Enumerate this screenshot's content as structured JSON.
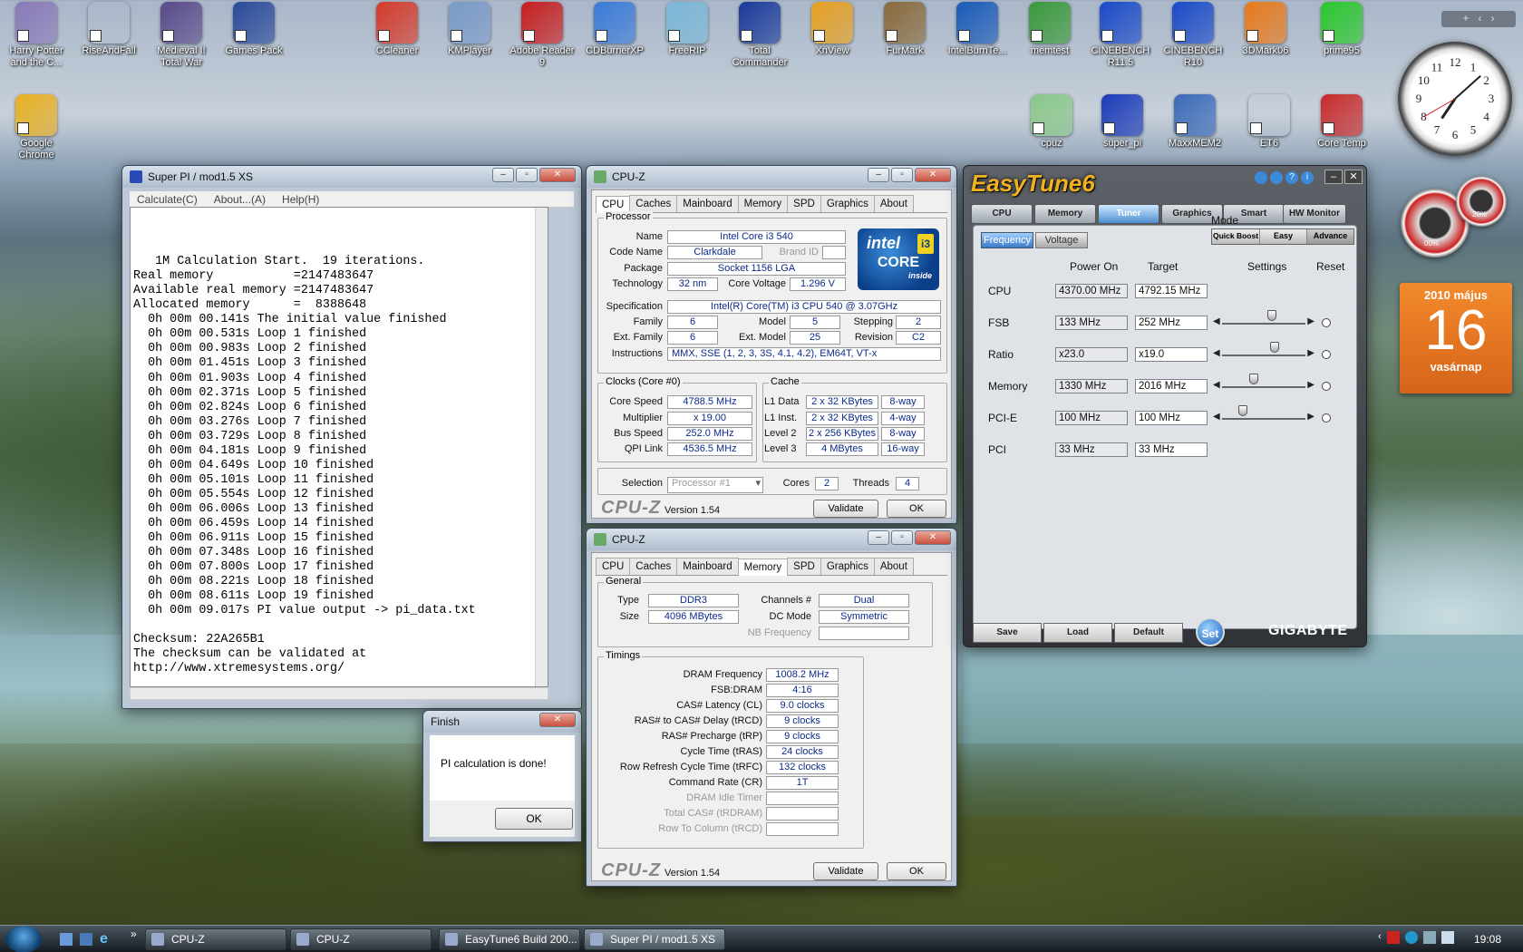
{
  "desktop_icons": [
    {
      "label": "Harry Potter and the C...",
      "icon": "owl-icon",
      "color": "#8a7ab8"
    },
    {
      "label": "RiseAndFall",
      "icon": "star-emblem-icon",
      "color": "#333"
    },
    {
      "label": "Medieval II Total War",
      "icon": "shield-icon",
      "color": "#5a4a8a"
    },
    {
      "label": "Games Pack",
      "icon": "g-logo-icon",
      "color": "#2a4a9a"
    },
    {
      "label": "CCleaner",
      "icon": "ccleaner-icon",
      "color": "#d63a2a"
    },
    {
      "label": "KMPlayer",
      "icon": "kmp-icon",
      "color": "#7a9ac8"
    },
    {
      "label": "Adobe Reader 9",
      "icon": "pdf-icon",
      "color": "#c81e1e"
    },
    {
      "label": "CDBurnerXP",
      "icon": "disc-icon",
      "color": "#3a7ad8"
    },
    {
      "label": "FreeRIP",
      "icon": "freerip-icon",
      "color": "#7ab8d8"
    },
    {
      "label": "Total Commander",
      "icon": "floppy-icon",
      "color": "#1a3a9a"
    },
    {
      "label": "XnView",
      "icon": "xnview-icon",
      "color": "#e8a020"
    },
    {
      "label": "FurMark",
      "icon": "furmark-icon",
      "color": "#8a6a3a"
    },
    {
      "label": "IntelBurnTe...",
      "icon": "intel-icon",
      "color": "#1a5ab8"
    },
    {
      "label": "memtest",
      "icon": "memtest-icon",
      "color": "#3a9a3a"
    },
    {
      "label": "CINEBENCH R11.5",
      "icon": "cinebench-icon",
      "color": "#1a4ac8"
    },
    {
      "label": "CINEBENCH R10",
      "icon": "cinebench-icon",
      "color": "#1a4ac8"
    },
    {
      "label": "3DMark06",
      "icon": "3dmark-icon",
      "color": "#e87a1a"
    },
    {
      "label": "prime95",
      "icon": "prime95-icon",
      "color": "#2ac82a"
    },
    {
      "label": "Google Chrome",
      "icon": "chrome-icon",
      "color": "#e8b020"
    },
    {
      "label": "cpuz",
      "icon": "cpuz-icon",
      "color": "#8ac88a"
    },
    {
      "label": "super_pi",
      "icon": "superpi-icon",
      "color": "#1a3ab8"
    },
    {
      "label": "MaxxMEM2",
      "icon": "gear-icon",
      "color": "#3a6ab8"
    },
    {
      "label": "ET6",
      "icon": "steering-wheel-icon",
      "color": "#666"
    },
    {
      "label": "Core Temp",
      "icon": "thermometer-icon",
      "color": "#c82a2a"
    }
  ],
  "superpi": {
    "title": "Super PI / mod1.5 XS",
    "menu": [
      "Calculate(C)",
      "About...(A)",
      "Help(H)"
    ],
    "lines": [
      "   1M Calculation Start.  19 iterations.",
      "Real memory           =2147483647",
      "Available real memory =2147483647",
      "Allocated memory      =  8388648",
      "  0h 00m 00.141s The initial value finished",
      "  0h 00m 00.531s Loop 1 finished",
      "  0h 00m 00.983s Loop 2 finished",
      "  0h 00m 01.451s Loop 3 finished",
      "  0h 00m 01.903s Loop 4 finished",
      "  0h 00m 02.371s Loop 5 finished",
      "  0h 00m 02.824s Loop 6 finished",
      "  0h 00m 03.276s Loop 7 finished",
      "  0h 00m 03.729s Loop 8 finished",
      "  0h 00m 04.181s Loop 9 finished",
      "  0h 00m 04.649s Loop 10 finished",
      "  0h 00m 05.101s Loop 11 finished",
      "  0h 00m 05.554s Loop 12 finished",
      "  0h 00m 06.006s Loop 13 finished",
      "  0h 00m 06.459s Loop 14 finished",
      "  0h 00m 06.911s Loop 15 finished",
      "  0h 00m 07.348s Loop 16 finished",
      "  0h 00m 07.800s Loop 17 finished",
      "  0h 00m 08.221s Loop 18 finished",
      "  0h 00m 08.611s Loop 19 finished",
      "  0h 00m 09.017s PI value output -> pi_data.txt",
      "",
      "Checksum: 22A265B1",
      "The checksum can be validated at",
      "http://www.xtremesystems.org/"
    ]
  },
  "finish_dialog": {
    "title": "Finish",
    "message": "PI calculation is done!",
    "ok": "OK"
  },
  "cpuz_tabs": [
    "CPU",
    "Caches",
    "Mainboard",
    "Memory",
    "SPD",
    "Graphics",
    "About"
  ],
  "cpuz1": {
    "title": "CPU-Z",
    "processor_label": "Processor",
    "name_label": "Name",
    "name": "Intel Core i3 540",
    "codename_label": "Code Name",
    "codename": "Clarkdale",
    "brandid_label": "Brand ID",
    "package_label": "Package",
    "package": "Socket 1156 LGA",
    "tech_label": "Technology",
    "tech": "32 nm",
    "voltage_label": "Core Voltage",
    "voltage": "1.296 V",
    "spec_label": "Specification",
    "spec": "Intel(R) Core(TM) i3 CPU       540  @ 3.07GHz",
    "family_label": "Family",
    "family": "6",
    "model_label": "Model",
    "model": "5",
    "stepping_label": "Stepping",
    "stepping": "2",
    "extfamily_label": "Ext. Family",
    "extfamily": "6",
    "extmodel_label": "Ext. Model",
    "extmodel": "25",
    "revision_label": "Revision",
    "revision": "C2",
    "instr_label": "Instructions",
    "instr": "MMX, SSE (1, 2, 3, 3S, 4.1, 4.2), EM64T, VT-x",
    "clocks_label": "Clocks (Core #0)",
    "corespeed_label": "Core Speed",
    "corespeed": "4788.5 MHz",
    "mult_label": "Multiplier",
    "mult": "x 19.00",
    "bus_label": "Bus Speed",
    "bus": "252.0 MHz",
    "qpi_label": "QPI Link",
    "qpi": "4536.5 MHz",
    "cache_label": "Cache",
    "l1d_label": "L1 Data",
    "l1d": "2 x 32 KBytes",
    "l1d_way": "8-way",
    "l1i_label": "L1 Inst.",
    "l1i": "2 x 32 KBytes",
    "l1i_way": "4-way",
    "l2_label": "Level 2",
    "l2": "2 x 256 KBytes",
    "l2_way": "8-way",
    "l3_label": "Level 3",
    "l3": "4 MBytes",
    "l3_way": "16-way",
    "selection_label": "Selection",
    "selection": "Processor #1",
    "cores_label": "Cores",
    "cores": "2",
    "threads_label": "Threads",
    "threads": "4",
    "brand": "CPU-Z",
    "version": "Version 1.54",
    "validate": "Validate",
    "ok": "OK",
    "intel_badge": {
      "line1": "intel",
      "line2": "i3",
      "line3": "CORE",
      "line4": "inside"
    }
  },
  "cpuz2": {
    "title": "CPU-Z",
    "general_label": "General",
    "type_label": "Type",
    "type": "DDR3",
    "channels_label": "Channels #",
    "channels": "Dual",
    "size_label": "Size",
    "size": "4096 MBytes",
    "dcmode_label": "DC Mode",
    "dcmode": "Symmetric",
    "nbfreq_label": "NB Frequency",
    "timings_label": "Timings",
    "timings": [
      {
        "label": "DRAM Frequency",
        "value": "1008.2 MHz"
      },
      {
        "label": "FSB:DRAM",
        "value": "4:16"
      },
      {
        "label": "CAS# Latency (CL)",
        "value": "9.0 clocks"
      },
      {
        "label": "RAS# to CAS# Delay (tRCD)",
        "value": "9 clocks"
      },
      {
        "label": "RAS# Precharge (tRP)",
        "value": "9 clocks"
      },
      {
        "label": "Cycle Time (tRAS)",
        "value": "24 clocks"
      },
      {
        "label": "Row Refresh Cycle Time (tRFC)",
        "value": "132 clocks"
      },
      {
        "label": "Command Rate (CR)",
        "value": "1T"
      },
      {
        "label": "DRAM Idle Timer",
        "value": ""
      },
      {
        "label": "Total CAS# (tRDRAM)",
        "value": ""
      },
      {
        "label": "Row To Column (tRCD)",
        "value": ""
      }
    ],
    "brand": "CPU-Z",
    "version": "Version 1.54",
    "validate": "Validate",
    "ok": "OK"
  },
  "easytune": {
    "logo": "EasyTune6",
    "tabs": [
      "CPU",
      "Memory",
      "Tuner",
      "Graphics",
      "Smart",
      "HW Monitor"
    ],
    "subtabs": [
      "Frequency",
      "Voltage"
    ],
    "mode_label": "Mode",
    "modes": [
      "Quick Boost",
      "Easy",
      "Advance"
    ],
    "col_poweron": "Power On",
    "col_target": "Target",
    "col_settings": "Settings",
    "col_reset": "Reset",
    "rows": [
      {
        "name": "CPU",
        "power_on": "4370.00 MHz",
        "target": "4792.15 MHz",
        "slider": null
      },
      {
        "name": "FSB",
        "power_on": "133 MHz",
        "target": "252 MHz",
        "slider": 0.6
      },
      {
        "name": "Ratio",
        "power_on": "x23.0",
        "target": "x19.0",
        "slider": 0.63
      },
      {
        "name": "Memory",
        "power_on": "1330 MHz",
        "target": "2016 MHz",
        "slider": 0.38
      },
      {
        "name": "PCI-E",
        "power_on": "100 MHz",
        "target": "100 MHz",
        "slider": 0.25
      },
      {
        "name": "PCI",
        "power_on": "33 MHz",
        "target": "33 MHz",
        "slider": null
      }
    ],
    "buttons": [
      "Save",
      "Load",
      "Default"
    ],
    "set": "Set",
    "brand": "GIGABYTE"
  },
  "calendar": {
    "month": "2010 május",
    "day": "16",
    "weekday": "vasárnap"
  },
  "meters": {
    "cpu": "00%",
    "mem": "20%"
  },
  "clock_numbers": [
    "12",
    "1",
    "2",
    "3",
    "4",
    "5",
    "6",
    "7",
    "8",
    "9",
    "10",
    "11"
  ],
  "taskbar": {
    "items": [
      "CPU-Z",
      "CPU-Z",
      "EasyTune6 Build 200...",
      "Super PI / mod1.5 XS"
    ],
    "time": "19:08",
    "quicklaunch_chevron": "»"
  }
}
